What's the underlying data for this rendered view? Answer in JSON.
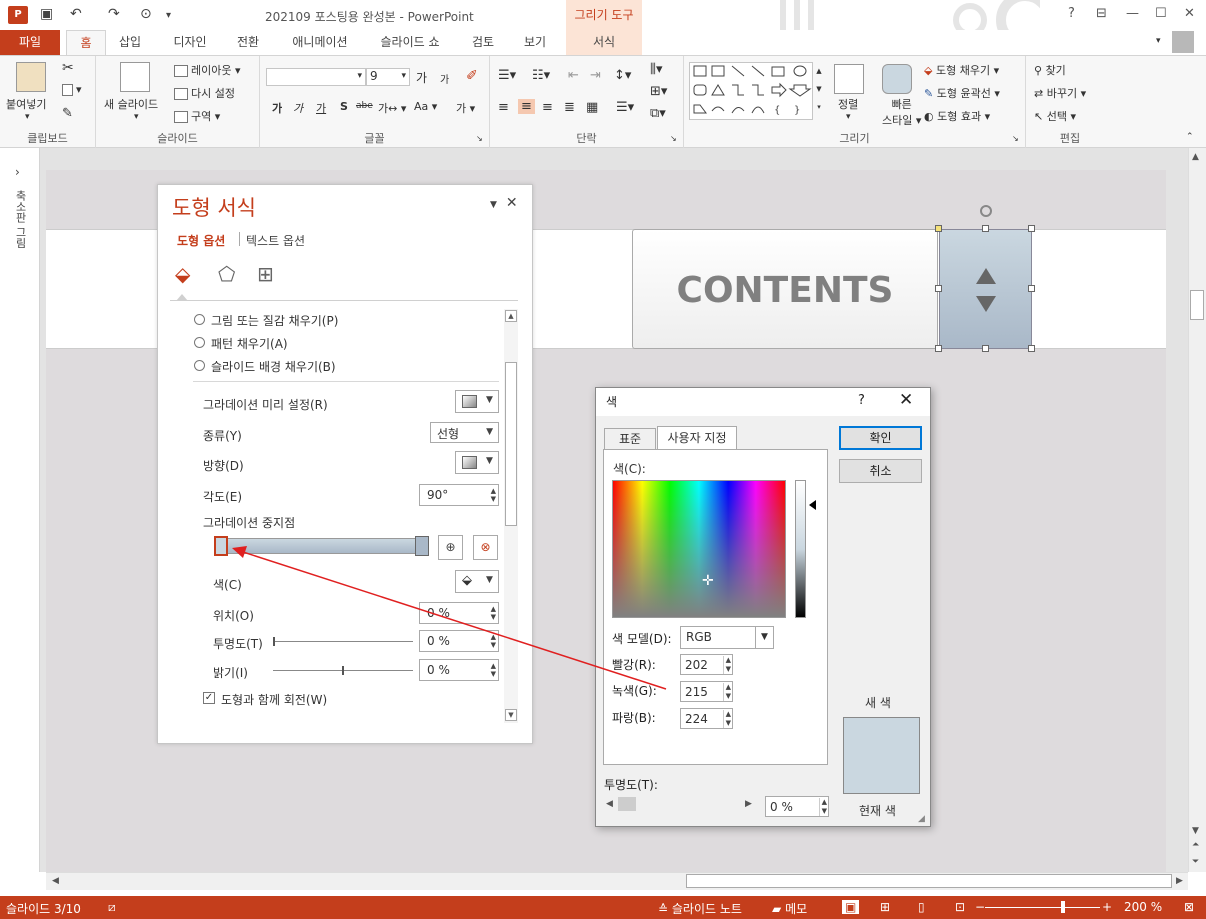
{
  "titlebar": {
    "app_logo": "P",
    "doc_title": "202109 포스팅용 완성본 - PowerPoint",
    "tools_band": "그리기 도구",
    "help": "?",
    "qat_icons": [
      "save-icon",
      "undo-icon",
      "redo-icon",
      "start-icon"
    ]
  },
  "tabs": {
    "file": "파일",
    "items": [
      "홈",
      "삽입",
      "디자인",
      "전환",
      "애니메이션",
      "슬라이드 쇼",
      "검토",
      "보기",
      "서식"
    ],
    "active": "홈"
  },
  "ribbon": {
    "clipboard": {
      "label": "클립보드",
      "paste": "붙여넣기"
    },
    "slides": {
      "label": "슬라이드",
      "new_slide": "새 슬라이드",
      "layout": "레이아웃",
      "reset": "다시 설정",
      "section": "구역"
    },
    "font": {
      "label": "글꼴",
      "font_name": "",
      "font_size": "9",
      "bold": "가",
      "italic": "가",
      "underline": "가",
      "shadow": "S",
      "strike": "abe",
      "spacing": "가↔",
      "case": "Aa",
      "grow": "가",
      "shrink": "가",
      "clear": "가"
    },
    "paragraph": {
      "label": "단락"
    },
    "drawing": {
      "label": "그리기",
      "arrange": "정렬",
      "quick_styles": "빠른\n스타일",
      "fill": "도형 채우기",
      "outline": "도형 윤곽선",
      "effects": "도형 효과"
    },
    "editing": {
      "label": "편집",
      "find": "찾기",
      "replace": "바꾸기",
      "select": "선택"
    }
  },
  "thumb_strip": {
    "label": "축소판 그림"
  },
  "slide": {
    "title": "CONTENTS"
  },
  "format_pane": {
    "title": "도형 서식",
    "tab_shape": "도형 옵션",
    "tab_text": "텍스트 옵션",
    "fill_picture": "그림 또는 질감 채우기(P)",
    "fill_pattern": "패턴 채우기(A)",
    "fill_background": "슬라이드 배경 채우기(B)",
    "gradient_preset": "그라데이션 미리 설정(R)",
    "type_label": "종류(Y)",
    "type_value": "선형",
    "direction": "방향(D)",
    "angle_label": "각도(E)",
    "angle_value": "90°",
    "gradient_stops": "그라데이션 중지점",
    "color_label": "색(C)",
    "position_label": "위치(O)",
    "position_value": "0 %",
    "transparency_label": "투명도(T)",
    "transparency_value": "0 %",
    "brightness_label": "밝기(I)",
    "brightness_value": "0 %",
    "rotate_with_shape": "도형과 함께 회전(W)"
  },
  "color_dialog": {
    "title": "색",
    "help": "?",
    "tab_standard": "표준",
    "tab_custom": "사용자 지정",
    "colors_label": "색(C):",
    "model_label": "색 모델(D):",
    "model_value": "RGB",
    "red_label": "빨강(R):",
    "red_value": "202",
    "green_label": "녹색(G):",
    "green_value": "215",
    "blue_label": "파랑(B):",
    "blue_value": "224",
    "transparency_label": "투명도(T):",
    "transparency_value": "0 %",
    "ok": "확인",
    "cancel": "취소",
    "new_label": "새 색",
    "current_label": "현재 색",
    "preview_color": "#cad7e0"
  },
  "statusbar": {
    "slide_info": "슬라이드 3/10",
    "notes": "슬라이드 노트",
    "comments": "메모",
    "zoom": "200 %"
  },
  "colors": {
    "accent": "#c43e1c",
    "shape_fill_top": "#cad7e0",
    "shape_fill_bottom": "#a9b8c8",
    "annotation": "#e02020"
  }
}
